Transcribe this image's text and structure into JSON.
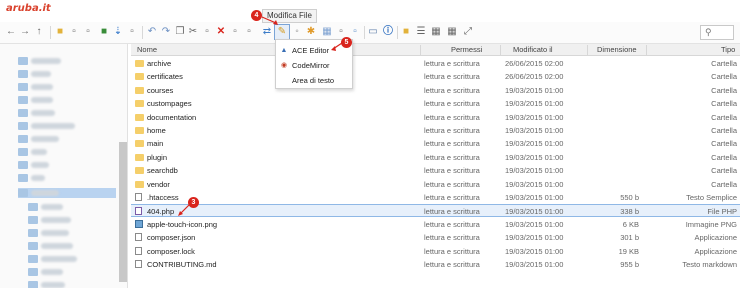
{
  "app": {
    "logo_text": "aruba.it"
  },
  "toolbar": {
    "tooltip": "Modifica File",
    "search_placeholder": ""
  },
  "edit_menu": {
    "items": [
      {
        "label": "ACE Editor",
        "icon": "ace-icon"
      },
      {
        "label": "CodeMirror",
        "icon": "codemirror-icon"
      },
      {
        "label": "Area di testo",
        "icon": ""
      }
    ]
  },
  "table": {
    "headers": {
      "name": "Nome",
      "perms": "Permessi",
      "modified": "Modificato il",
      "size": "Dimensione",
      "type": "Tipo"
    },
    "rows": [
      {
        "name": "archive",
        "perms": "lettura e scrittura",
        "modified": "26/06/2015 02:00",
        "size": "",
        "type": "Cartella",
        "kind": "folder"
      },
      {
        "name": "certificates",
        "perms": "lettura e scrittura",
        "modified": "26/06/2015 02:00",
        "size": "",
        "type": "Cartella",
        "kind": "folder"
      },
      {
        "name": "courses",
        "perms": "lettura e scrittura",
        "modified": "19/03/2015 01:00",
        "size": "",
        "type": "Cartella",
        "kind": "folder"
      },
      {
        "name": "custompages",
        "perms": "lettura e scrittura",
        "modified": "19/03/2015 01:00",
        "size": "",
        "type": "Cartella",
        "kind": "folder"
      },
      {
        "name": "documentation",
        "perms": "lettura e scrittura",
        "modified": "19/03/2015 01:00",
        "size": "",
        "type": "Cartella",
        "kind": "folder"
      },
      {
        "name": "home",
        "perms": "lettura e scrittura",
        "modified": "19/03/2015 01:00",
        "size": "",
        "type": "Cartella",
        "kind": "folder"
      },
      {
        "name": "main",
        "perms": "lettura e scrittura",
        "modified": "19/03/2015 01:00",
        "size": "",
        "type": "Cartella",
        "kind": "folder"
      },
      {
        "name": "plugin",
        "perms": "lettura e scrittura",
        "modified": "19/03/2015 01:00",
        "size": "",
        "type": "Cartella",
        "kind": "folder"
      },
      {
        "name": "searchdb",
        "perms": "lettura e scrittura",
        "modified": "19/03/2015 01:00",
        "size": "",
        "type": "Cartella",
        "kind": "folder"
      },
      {
        "name": "vendor",
        "perms": "lettura e scrittura",
        "modified": "19/03/2015 01:00",
        "size": "",
        "type": "Cartella",
        "kind": "folder"
      },
      {
        "name": ".htaccess",
        "perms": "lettura e scrittura",
        "modified": "19/03/2015 01:00",
        "size": "550 b",
        "type": "Testo Semplice",
        "kind": "file"
      },
      {
        "name": "404.php",
        "perms": "lettura e scrittura",
        "modified": "19/03/2015 01:00",
        "size": "338 b",
        "type": "File PHP",
        "kind": "php"
      },
      {
        "name": "apple-touch-icon.png",
        "perms": "lettura e scrittura",
        "modified": "19/03/2015 01:00",
        "size": "6 KB",
        "type": "Immagine PNG",
        "kind": "image"
      },
      {
        "name": "composer.json",
        "perms": "lettura e scrittura",
        "modified": "19/03/2015 01:00",
        "size": "301 b",
        "type": "Applicazione",
        "kind": "file"
      },
      {
        "name": "composer.lock",
        "perms": "lettura e scrittura",
        "modified": "19/03/2015 01:00",
        "size": "19 KB",
        "type": "Applicazione",
        "kind": "file"
      },
      {
        "name": "CONTRIBUTING.md",
        "perms": "lettura e scrittura",
        "modified": "19/03/2015 01:00",
        "size": "955 b",
        "type": "Testo markdown",
        "kind": "file"
      }
    ]
  },
  "badges": {
    "b3": "3",
    "b4": "4",
    "b5": "5"
  },
  "colors": {
    "accent": "#d9251d",
    "folder": "#f5cf6a",
    "selection": "#e7f0fb"
  }
}
